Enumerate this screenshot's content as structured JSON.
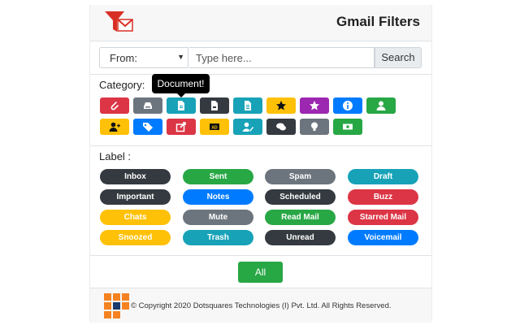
{
  "header": {
    "title": "Gmail Filters"
  },
  "search": {
    "filter_value": "From:",
    "placeholder": "Type here...",
    "button_label": "Search"
  },
  "category": {
    "heading": "Category:",
    "tooltip": "Document!",
    "items": [
      {
        "icon": "paperclip-icon",
        "color": "#dc3545"
      },
      {
        "icon": "inbox-tray-icon",
        "color": "#6c757d"
      },
      {
        "icon": "document-icon",
        "color": "#17a2b8"
      },
      {
        "icon": "file-icon",
        "color": "#343a40"
      },
      {
        "icon": "file-alt-icon",
        "color": "#17a2b8"
      },
      {
        "icon": "star-icon",
        "color": "#ffc107"
      },
      {
        "icon": "star-icon",
        "color": "#9c27b0"
      },
      {
        "icon": "info-icon",
        "color": "#007bff"
      },
      {
        "icon": "user-icon",
        "color": "#28a745"
      },
      {
        "icon": "user-plus-icon",
        "color": "#ffc107"
      },
      {
        "icon": "tag-icon",
        "color": "#007bff"
      },
      {
        "icon": "share-icon",
        "color": "#dc3545"
      },
      {
        "icon": "ad-icon",
        "color": "#ffc107"
      },
      {
        "icon": "user-edit-icon",
        "color": "#17a2b8"
      },
      {
        "icon": "comments-icon",
        "color": "#343a40"
      },
      {
        "icon": "lightbulb-icon",
        "color": "#6c757d"
      },
      {
        "icon": "money-icon",
        "color": "#28a745"
      }
    ]
  },
  "label": {
    "heading": "Label :",
    "items": [
      {
        "text": "Inbox",
        "color": "#343a40"
      },
      {
        "text": "Sent",
        "color": "#28a745"
      },
      {
        "text": "Spam",
        "color": "#6c757d"
      },
      {
        "text": "Draft",
        "color": "#17a2b8"
      },
      {
        "text": "Important",
        "color": "#343a40"
      },
      {
        "text": "Notes",
        "color": "#007bff"
      },
      {
        "text": "Scheduled",
        "color": "#343a40"
      },
      {
        "text": "Buzz",
        "color": "#dc3545"
      },
      {
        "text": "Chats",
        "color": "#ffc107"
      },
      {
        "text": "Mute",
        "color": "#6c757d"
      },
      {
        "text": "Read Mail",
        "color": "#28a745"
      },
      {
        "text": "Starred Mail",
        "color": "#dc3545"
      },
      {
        "text": "Snoozed",
        "color": "#ffc107"
      },
      {
        "text": "Trash",
        "color": "#17a2b8"
      },
      {
        "text": "Unread",
        "color": "#343a40"
      },
      {
        "text": "Voicemail",
        "color": "#007bff"
      }
    ]
  },
  "all_button": "All",
  "footer": {
    "copyright": "© Copyright 2020 Dotsquares Technologies (I) Pvt. Ltd. All Rights Reserved."
  }
}
